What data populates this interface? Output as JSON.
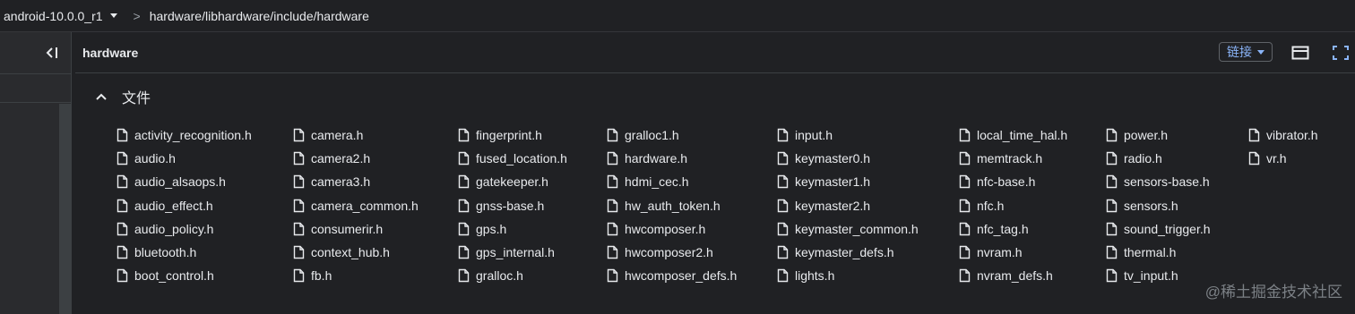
{
  "topbar": {
    "branch": "android-10.0.0_r1",
    "separator": ">",
    "path": "hardware/libhardware/include/hardware"
  },
  "main": {
    "title": "hardware",
    "link_button": "链接",
    "section_title": "文件"
  },
  "files": {
    "columns": [
      [
        "activity_recognition.h",
        "audio.h",
        "audio_alsaops.h",
        "audio_effect.h",
        "audio_policy.h",
        "bluetooth.h",
        "boot_control.h"
      ],
      [
        "camera.h",
        "camera2.h",
        "camera3.h",
        "camera_common.h",
        "consumerir.h",
        "context_hub.h",
        "fb.h"
      ],
      [
        "fingerprint.h",
        "fused_location.h",
        "gatekeeper.h",
        "gnss-base.h",
        "gps.h",
        "gps_internal.h",
        "gralloc.h"
      ],
      [
        "gralloc1.h",
        "hardware.h",
        "hdmi_cec.h",
        "hw_auth_token.h",
        "hwcomposer.h",
        "hwcomposer2.h",
        "hwcomposer_defs.h"
      ],
      [
        "input.h",
        "keymaster0.h",
        "keymaster1.h",
        "keymaster2.h",
        "keymaster_common.h",
        "keymaster_defs.h",
        "lights.h"
      ],
      [
        "local_time_hal.h",
        "memtrack.h",
        "nfc-base.h",
        "nfc.h",
        "nfc_tag.h",
        "nvram.h",
        "nvram_defs.h"
      ],
      [
        "power.h",
        "radio.h",
        "sensors-base.h",
        "sensors.h",
        "sound_trigger.h",
        "thermal.h",
        "tv_input.h"
      ],
      [
        "vibrator.h",
        "vr.h"
      ]
    ]
  },
  "watermark": "@稀土掘金技术社区",
  "icons": {
    "file": "file-icon",
    "collapse": "collapse-panel-icon",
    "layout": "layout-icon",
    "fullscreen": "fullscreen-icon",
    "chevron": "chevron-up-icon"
  },
  "colors": {
    "background": "#202124",
    "accent": "#8ab4f8",
    "text": "#e8eaed"
  }
}
